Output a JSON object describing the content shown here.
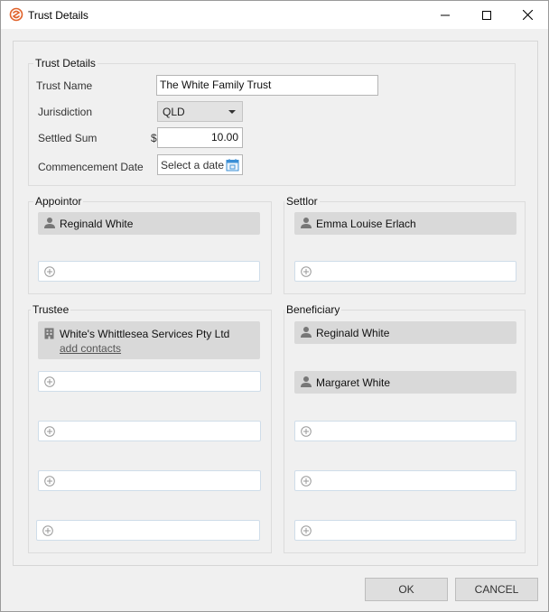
{
  "window": {
    "title": "Trust Details",
    "controls": {
      "minimize": "minimize",
      "maximize": "maximize",
      "close": "close"
    }
  },
  "trust_details": {
    "section_title": "Trust Details",
    "trust_name_label": "Trust Name",
    "trust_name_value": "The White Family Trust",
    "jurisdiction_label": "Jurisdiction",
    "jurisdiction_value": "QLD",
    "settled_sum_label": "Settled Sum",
    "currency_symbol": "$",
    "settled_sum_value": "10.00",
    "commencement_label": "Commencement Date",
    "commencement_placeholder": "Select a date"
  },
  "appointor": {
    "title": "Appointor",
    "members": [
      "Reginald White"
    ]
  },
  "settlor": {
    "title": "Settlor",
    "members": [
      "Emma Louise Erlach"
    ]
  },
  "trustee": {
    "title": "Trustee",
    "company": "White's Whittlesea Services Pty Ltd",
    "add_contacts_link": "add contacts"
  },
  "beneficiary": {
    "title": "Beneficiary",
    "members": [
      "Reginald White",
      "Margaret White"
    ]
  },
  "buttons": {
    "ok": "OK",
    "cancel": "CANCEL"
  },
  "colors": {
    "app_icon": "#e0622a",
    "calendar_icon": "#3b8fd6",
    "card_background": "#d9d9d9"
  }
}
